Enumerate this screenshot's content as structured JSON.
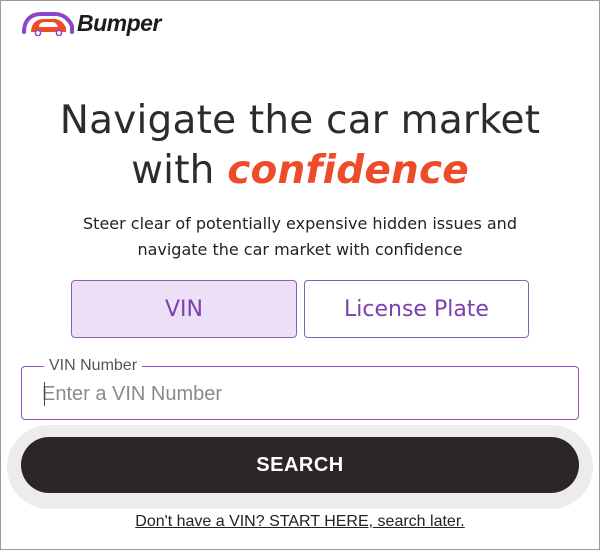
{
  "header": {
    "logo_text": "Bumper",
    "logo_icon": "car-icon",
    "brand_colors": {
      "purple": "#7b3fb0",
      "red": "#ee4b2b"
    }
  },
  "hero": {
    "title_line1": "Navigate the car market",
    "title_line2_prefix": "with ",
    "title_line2_accent": "confidence",
    "subtitle_line1": "Steer clear of potentially expensive hidden issues and",
    "subtitle_line2": "navigate the car market with confidence"
  },
  "toggle": {
    "options": [
      {
        "label": "VIN",
        "selected": true
      },
      {
        "label": "License Plate",
        "selected": false
      }
    ]
  },
  "vin_field": {
    "label": "VIN Number",
    "placeholder": "Enter a VIN Number",
    "value": ""
  },
  "search_button": {
    "label": "SEARCH"
  },
  "footer": {
    "link_text": "Don't have a VIN? START HERE, search later."
  },
  "colors": {
    "accent_red": "#ee4b2b",
    "accent_purple": "#7b3fb0",
    "selected_tab_bg": "#ede0f6",
    "button_dark": "#2d2628"
  }
}
